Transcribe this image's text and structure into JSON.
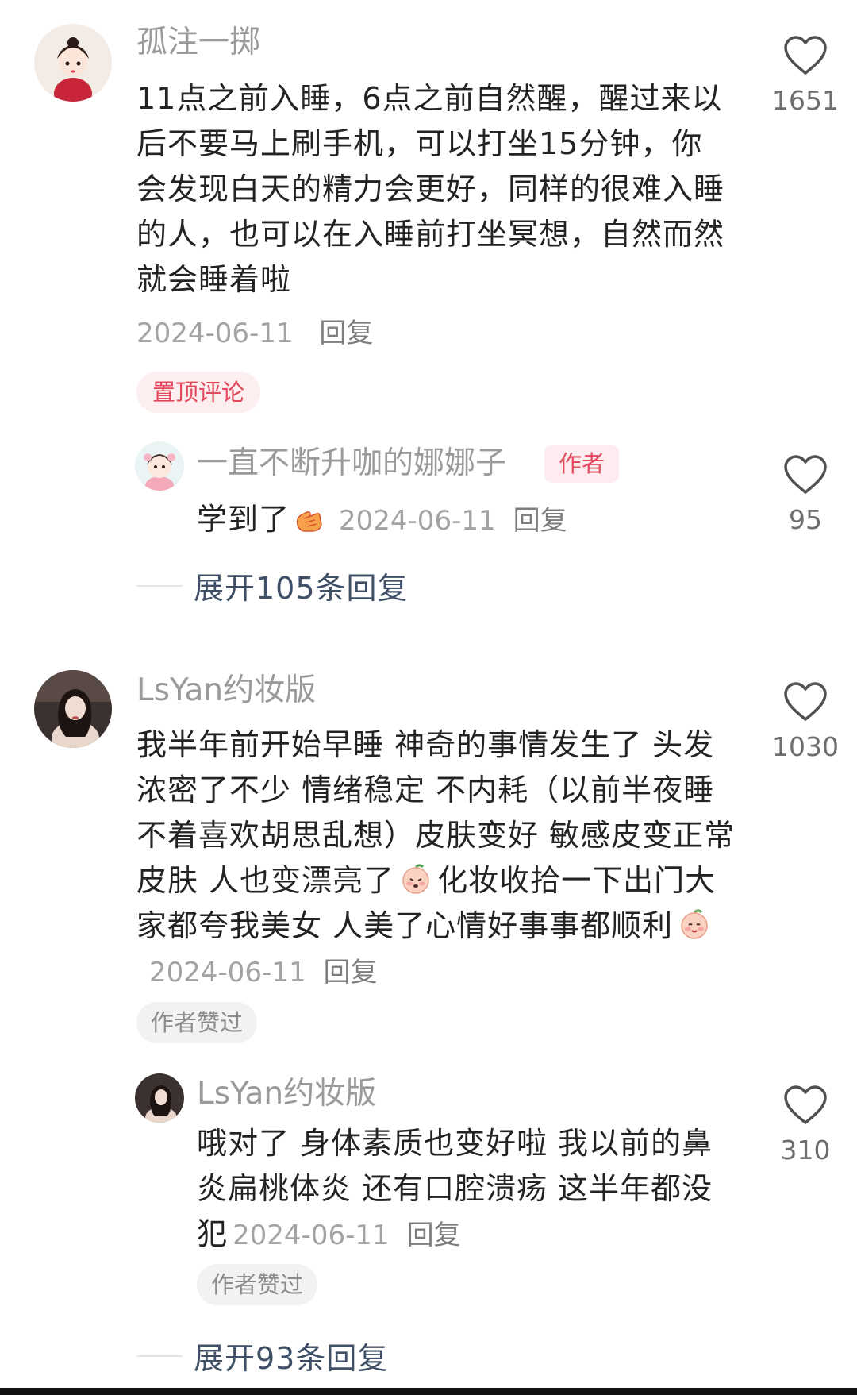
{
  "comments": [
    {
      "username": "孤注一掷",
      "avatar": "avatar-girl-red-dress",
      "text": "11点之前入睡，6点之前自然醒，醒过来以后不要马上刷手机，可以打坐15分钟，你会发现白天的精力会更好，同样的很难入睡的人，也可以在入睡前打坐冥想，自然而然就会睡着啦",
      "date": "2024-06-11",
      "reply_label": "回复",
      "badge": "置顶评论",
      "likes": "1651",
      "reply": {
        "username": "一直不断升咖的娜娜子",
        "author_badge": "作者",
        "text": "学到了",
        "emoji": "clap-hands-icon",
        "date": "2024-06-11",
        "reply_label": "回复",
        "likes": "95"
      },
      "expand_label": "展开105条回复"
    },
    {
      "username": "LsYan约妆版",
      "avatar": "avatar-woman-photo",
      "text": "我半年前开始早睡 神奇的事情发生了 头发浓密了不少 情绪稳定 不内耗（以前半夜睡不着喜欢胡思乱想）皮肤变好 敏感皮变正常皮肤 人也变漂亮了",
      "text_after_emoji": "化妆收拾一下出门大家都夸我美女 人美了心情好事事都顺利",
      "date": "2024-06-11",
      "reply_label": "回复",
      "badge": "作者赞过",
      "likes": "1030",
      "reply": {
        "username": "LsYan约妆版",
        "text": "哦对了 身体素质也变好啦 我以前的鼻炎扁桃体炎 还有口腔溃疡 这半年都没犯",
        "date": "2024-06-11",
        "reply_label": "回复",
        "badge": "作者赞过",
        "likes": "310"
      },
      "expand_label": "展开93条回复"
    }
  ],
  "colors": {
    "username": "#9a9a9a",
    "body_text": "#232323",
    "meta": "#a3a3a3",
    "accent_red": "#e2485c",
    "expand_text": "#3f4f66"
  }
}
